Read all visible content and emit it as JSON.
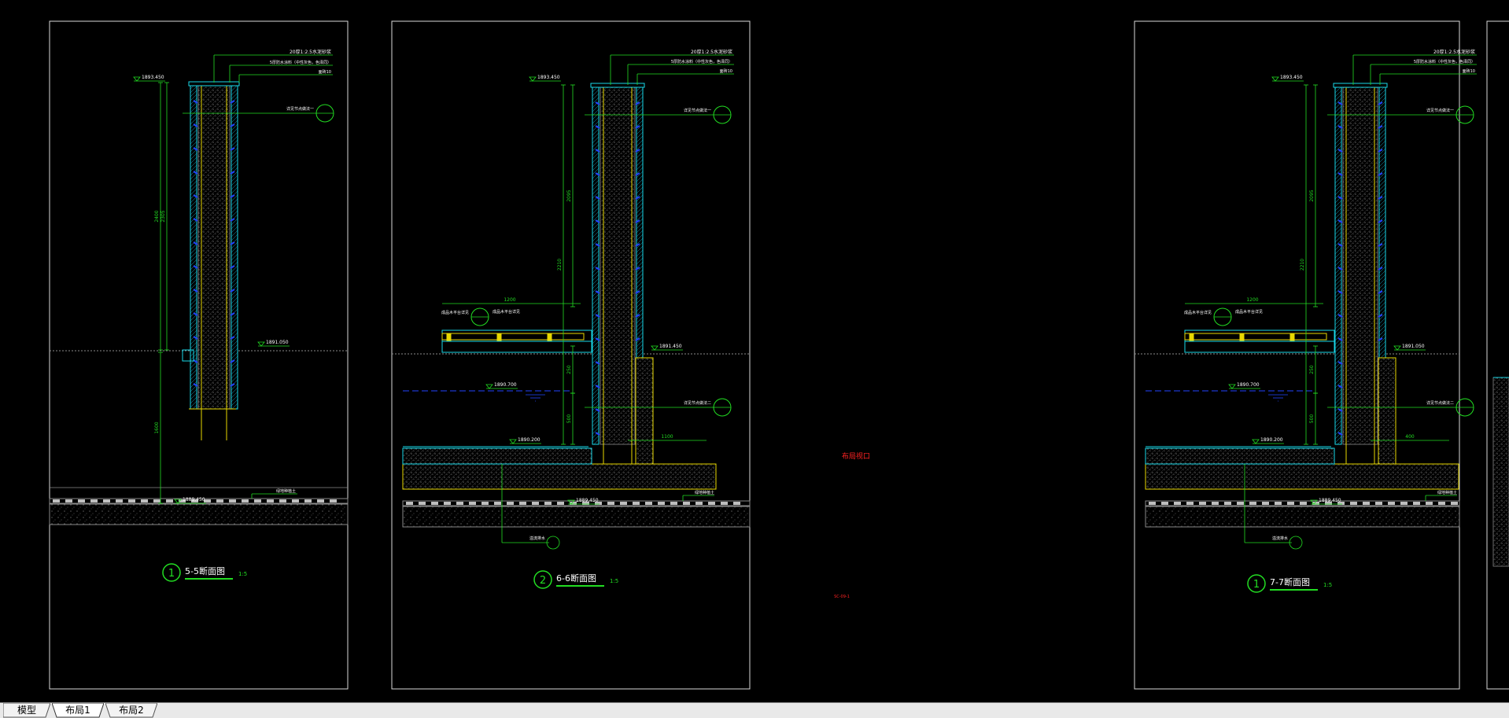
{
  "layout_tabs": [
    {
      "label": "模型",
      "active": false
    },
    {
      "label": "布局1",
      "active": true
    },
    {
      "label": "布局2",
      "active": false
    }
  ],
  "colors": {
    "background": "#000000",
    "frame": "#d9d9d9",
    "green": "#22dd22",
    "yellow": "#e8d800",
    "cyan": "#18d8e8",
    "blue": "#2244ff",
    "red": "#ff2222",
    "grey": "#8a8a8a",
    "tabbar": "#e9e9e9"
  },
  "sheets": [
    {
      "title": "5-5断面图",
      "number": "1",
      "scale": "1:5",
      "notes": [
        "20厚1:2.5水泥砂浆",
        "5厚防水涂料（中性灰色，色泽同）",
        "面砖10"
      ],
      "callout": "详见节点做法一",
      "elev_top": "1893.450",
      "elev_mid": "1891.050",
      "elev_bot": "1889.450",
      "dims": [
        "2400",
        "2305",
        "1600"
      ],
      "ground_label": "绿地种植土"
    },
    {
      "title": "6-6断面图",
      "number": "2",
      "scale": "1:5",
      "notes": [
        "20厚1:2.5水泥砂浆",
        "5厚防水涂料（中性灰色，色泽同）",
        "面砖10"
      ],
      "callout": "详见节点做法一",
      "callout2": "详见节点做法二",
      "elev_top": "1893.450",
      "elev_mid": "1891.450",
      "elev_water": "1890.700",
      "elev_pool": "1890.200",
      "elev_bot": "1889.450",
      "dims": [
        "1200",
        "2095",
        "2210",
        "250",
        "500",
        "1100"
      ],
      "slab_label": "成品木平台详见",
      "ground_label": "绿地种植土",
      "drain_label": "溢流排水"
    },
    {
      "title": "7-7断面图",
      "number": "1",
      "scale": "1:5",
      "notes": [
        "20厚1:2.5水泥砂浆",
        "5厚防水涂料（中性灰色，色泽同）",
        "面砖10"
      ],
      "callout": "详见节点做法一",
      "callout2": "详见节点做法二",
      "elev_top": "1893.450",
      "elev_mid": "1891.050",
      "elev_water": "1890.700",
      "elev_pool": "1890.200",
      "elev_bot": "1889.450",
      "dims": [
        "1200",
        "2095",
        "2210",
        "250",
        "500",
        "400"
      ],
      "slab_label": "成品木平台详见",
      "ground_label": "绿地种植土",
      "drain_label": "溢流排水"
    }
  ],
  "center_note": "布局视口",
  "center_small": "SC-09-1"
}
